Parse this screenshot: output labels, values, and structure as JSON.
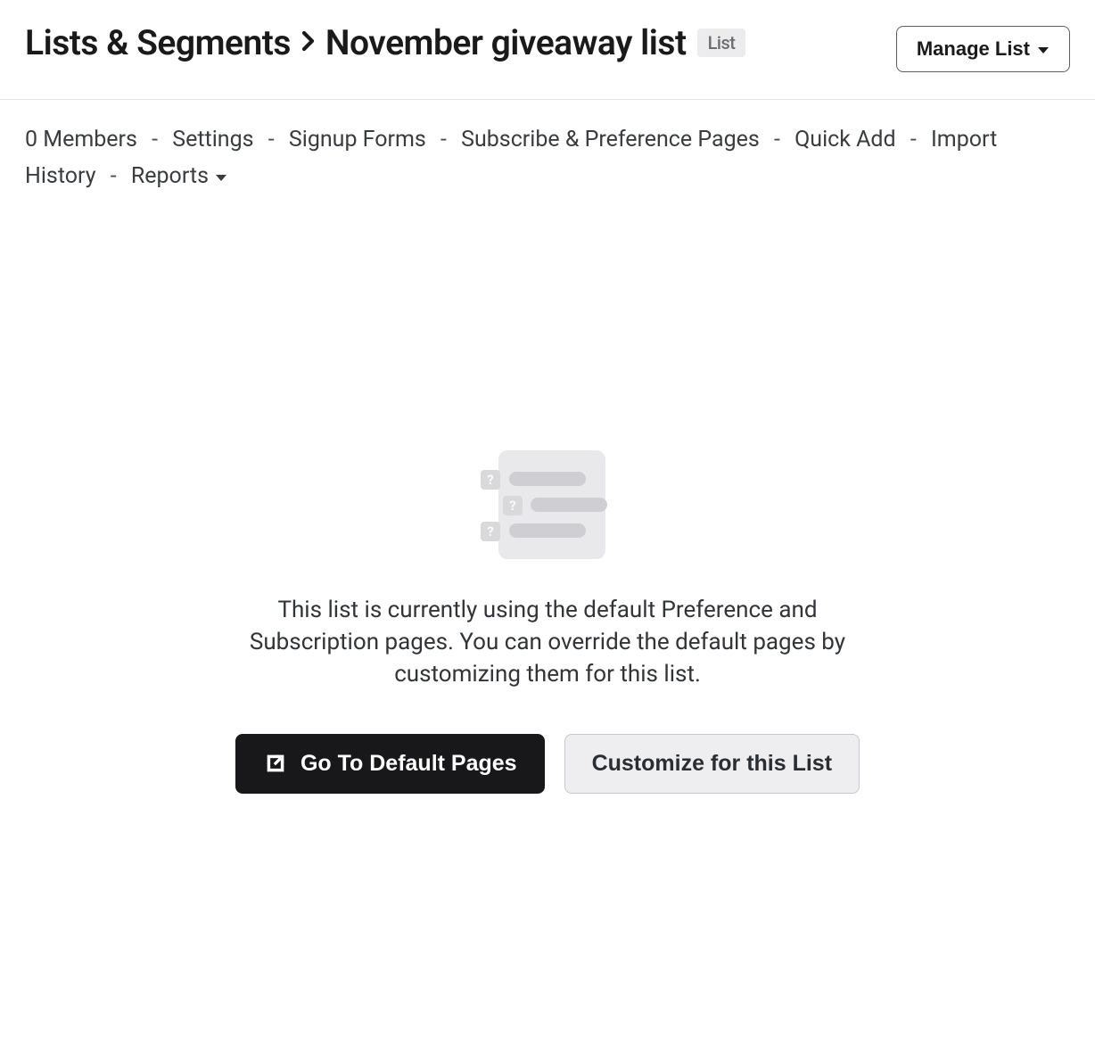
{
  "header": {
    "breadcrumb_parent": "Lists & Segments",
    "breadcrumb_current": "November giveaway list",
    "badge": "List",
    "manage_button": "Manage List"
  },
  "subnav": {
    "members": "0 Members",
    "settings": "Settings",
    "signup_forms": "Signup Forms",
    "subscribe_pages": "Subscribe & Preference Pages",
    "quick_add": "Quick Add",
    "import_history": "Import History",
    "reports": "Reports"
  },
  "empty_state": {
    "text": "This list is currently using the default Preference and Subscription pages. You can override the default pages by customizing them for this list.",
    "default_pages_button": "Go To Default Pages",
    "customize_button": "Customize for this List"
  }
}
